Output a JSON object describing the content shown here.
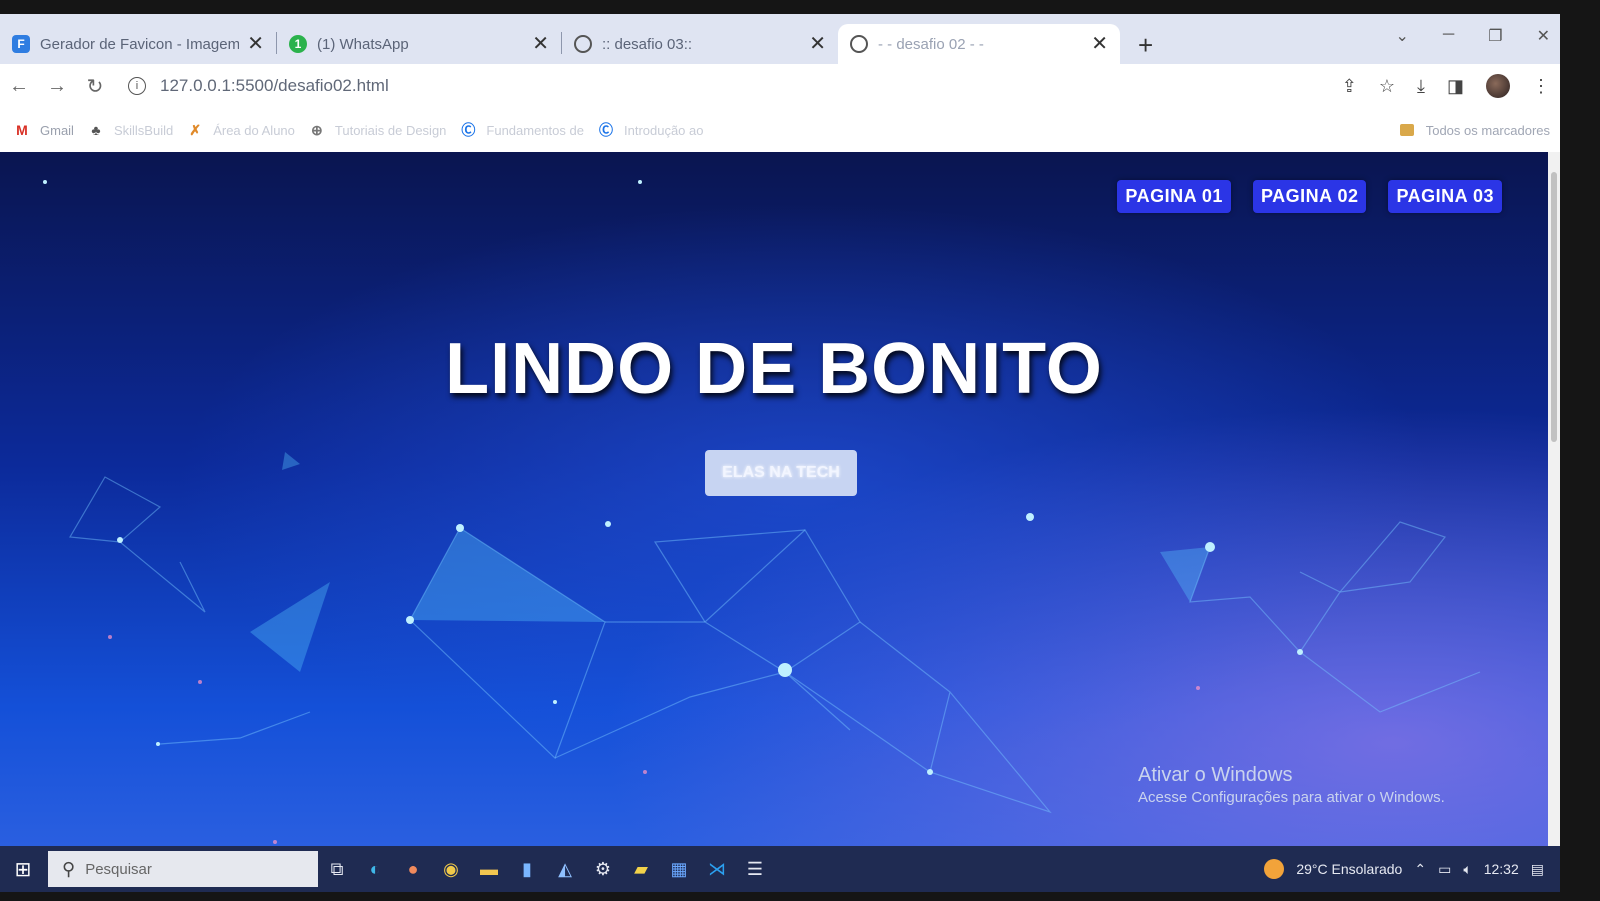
{
  "tabs": [
    {
      "title": "Gerador de Favicon - Imagem pa",
      "favicon": "F",
      "favicon_color": "#2f7de1",
      "active": false
    },
    {
      "title": "(1) WhatsApp",
      "favicon": "1",
      "favicon_color": "#2bb24c",
      "active": false
    },
    {
      "title": ":: desafio 03::",
      "favicon": "globe",
      "favicon_color": "#555555",
      "active": false
    },
    {
      "title": "- - desafio 02 - -",
      "favicon": "globe",
      "favicon_color": "#555555",
      "active": true
    }
  ],
  "toolbar": {
    "url": "127.0.0.1:5500/desafio02.html"
  },
  "bookmarks": [
    {
      "label": "Gmail",
      "icon": "gmail-icon"
    },
    {
      "label": "SkillsBuild",
      "icon": "skillsbuild-icon"
    },
    {
      "label": "Área do Aluno",
      "icon": "student-icon"
    },
    {
      "label": "Tutoriais de Design",
      "icon": "design-icon"
    },
    {
      "label": "Fundamentos de",
      "icon": "course-icon"
    },
    {
      "label": "Introdução ao",
      "icon": "course-icon"
    }
  ],
  "bookmarks_all": "Todos os marcadores",
  "page": {
    "nav": [
      "PAGINA 01",
      "PAGINA 02",
      "PAGINA 03"
    ],
    "title": "LINDO DE BONITO",
    "button": "ELAS NA TECH"
  },
  "watermark": {
    "title": "Ativar o Windows",
    "subtitle": "Acesse Configurações para ativar o Windows."
  },
  "taskbar": {
    "search_placeholder": "Pesquisar",
    "weather": "29°C  Ensolarado",
    "time": "12:32"
  },
  "colors": {
    "nav_button": "#2b35e6",
    "page_bg": "#0c2a9a",
    "taskbar": "#1f2b52"
  }
}
